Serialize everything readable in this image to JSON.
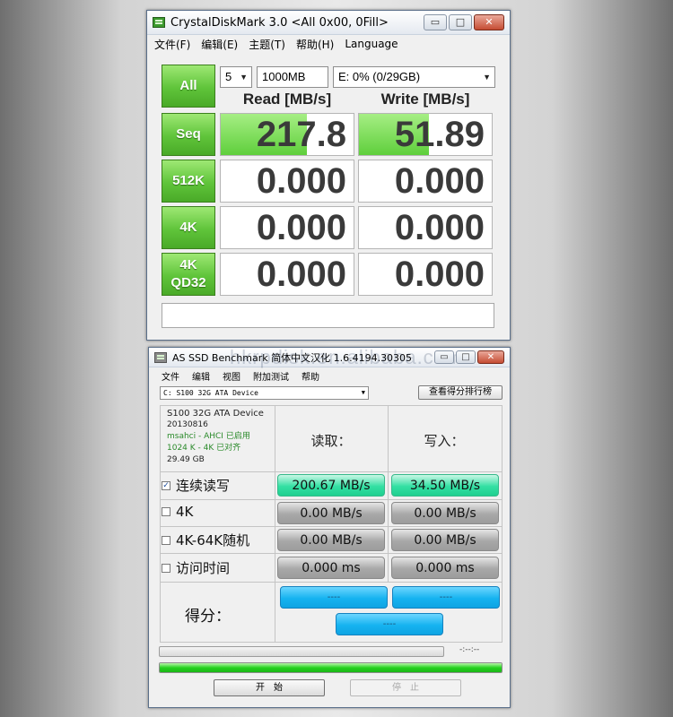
{
  "crystaldiskmark": {
    "title": "CrystalDiskMark 3.0 <All 0x00, 0Fill>",
    "window_buttons": {
      "minimize": "▭",
      "maximize": "□",
      "close": "✕"
    },
    "menu": [
      "文件(F)",
      "编辑(E)",
      "主题(T)",
      "帮助(H)",
      "Language"
    ],
    "all_button": "All",
    "count_select": "5",
    "size_select": "1000MB",
    "drive_select": "E: 0% (0/29GB)",
    "read_header": "Read [MB/s]",
    "write_header": "Write [MB/s]",
    "rows": [
      {
        "label": "Seq",
        "read": "217.8",
        "write": "51.89",
        "read_fill_pct": 65,
        "write_fill_pct": 53
      },
      {
        "label": "512K",
        "read": "0.000",
        "write": "0.000",
        "read_fill_pct": 0,
        "write_fill_pct": 0
      },
      {
        "label": "4K",
        "read": "0.000",
        "write": "0.000",
        "read_fill_pct": 0,
        "write_fill_pct": 0
      },
      {
        "label_line1": "4K",
        "label_line2": "QD32",
        "read": "0.000",
        "write": "0.000",
        "read_fill_pct": 0,
        "write_fill_pct": 0
      }
    ],
    "comment": ""
  },
  "as_ssd": {
    "title": "AS SSD Benchmark 简体中文汉化 1.6.4194.30305",
    "watermark": "hkrpdisk.en.alibaba.com",
    "window_buttons": {
      "minimize": "▭",
      "maximize": "□",
      "close": "✕"
    },
    "menu": [
      "文件",
      "编辑",
      "视图",
      "附加测试",
      "帮助"
    ],
    "drive_select": "C: S100 32G ATA Device",
    "rank_button": "查看得分排行榜",
    "info": {
      "model": "S100 32G ATA Device",
      "firmware": "20130816",
      "driver": "msahci - AHCI 已启用",
      "alignment": "1024 K - 4K 已对齐",
      "capacity": "29.49 GB"
    },
    "read_header": "读取：",
    "write_header": "写入：",
    "rows": [
      {
        "label": "连续读写",
        "checked": true,
        "read": "200.67 MB/s",
        "write": "34.50 MB/s"
      },
      {
        "label": "4K",
        "checked": false,
        "read": "0.00 MB/s",
        "write": "0.00 MB/s"
      },
      {
        "label": "4K-64K随机",
        "checked": false,
        "read": "0.00 MB/s",
        "write": "0.00 MB/s"
      },
      {
        "label": "访问时间",
        "checked": false,
        "read": "0.000 ms",
        "write": "0.000 ms"
      }
    ],
    "score_label": "得分：",
    "score_read": "----",
    "score_write": "----",
    "score_total": "----",
    "time": "-:--:--",
    "progress_pct": 100,
    "start_button": "开　始",
    "stop_button": "停　止",
    "checkbox_mark": "✓"
  }
}
